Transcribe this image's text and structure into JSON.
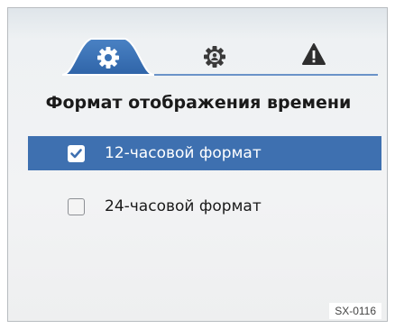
{
  "tabs": [
    {
      "icon": "gear-icon",
      "active": true
    },
    {
      "icon": "cog-person-icon",
      "active": false
    },
    {
      "icon": "warning-icon",
      "active": false
    }
  ],
  "title": "Формат отображения времени",
  "options": [
    {
      "label": "12-часовой формат",
      "checked": true
    },
    {
      "label": "24-часовой формат",
      "checked": false
    }
  ],
  "figure_code": "SX-0116",
  "colors": {
    "accent": "#3e70b0",
    "tab_line": "#6a93c8"
  }
}
